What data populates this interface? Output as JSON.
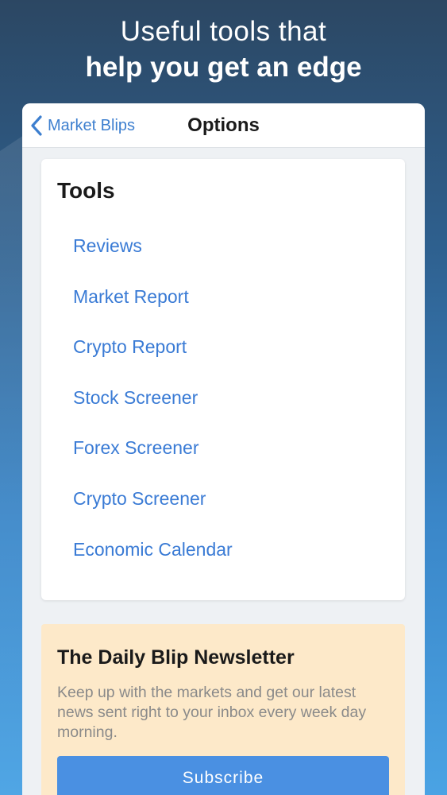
{
  "headline": {
    "line1": "Useful tools that",
    "line2": "help you get an edge"
  },
  "navbar": {
    "back_label": "Market Blips",
    "title": "Options"
  },
  "tools": {
    "title": "Tools",
    "items": [
      {
        "label": "Reviews"
      },
      {
        "label": "Market Report"
      },
      {
        "label": "Crypto Report"
      },
      {
        "label": "Stock Screener"
      },
      {
        "label": "Forex Screener"
      },
      {
        "label": "Crypto Screener"
      },
      {
        "label": "Economic Calendar"
      }
    ]
  },
  "newsletter": {
    "title": "The Daily Blip Newsletter",
    "description": "Keep up with the markets and get our latest news sent right to your inbox every week day morning.",
    "subscribe_label": "Subscribe"
  },
  "colors": {
    "accent": "#3a7bd5",
    "button": "#4a90e2",
    "newsletter_bg": "#fde9c9"
  },
  "icons": {
    "back": "chevron-left-icon"
  }
}
